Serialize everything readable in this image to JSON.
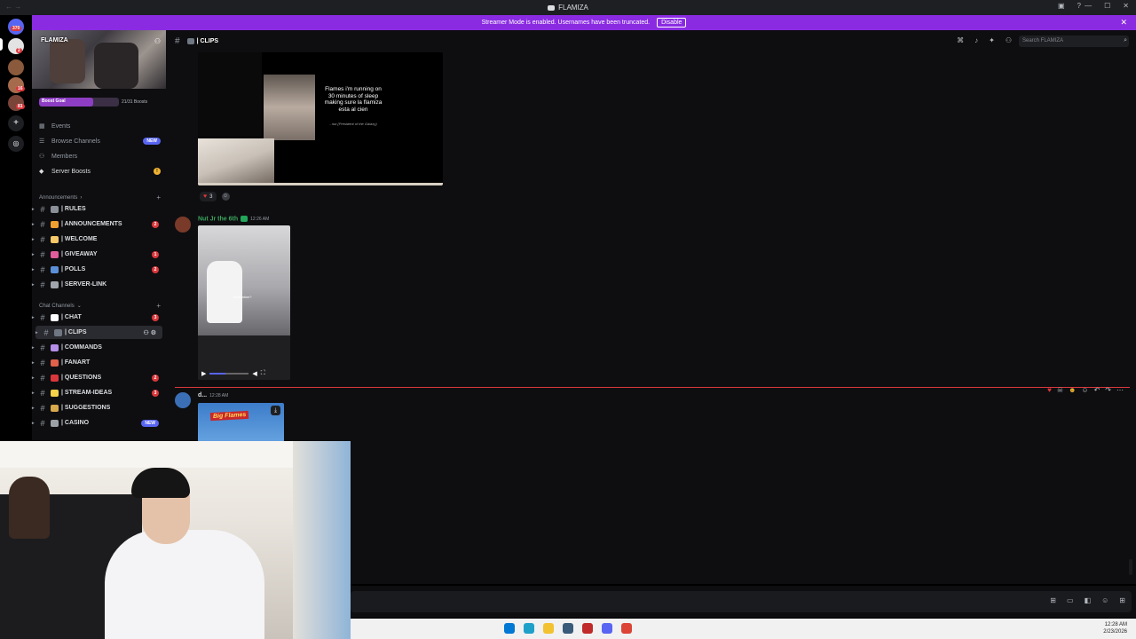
{
  "window": {
    "title": "FLAMIZA",
    "controls": [
      "—",
      "☐",
      "✕"
    ],
    "titlebar_icons": [
      "inbox-icon",
      "help-icon"
    ]
  },
  "banner": {
    "text": "Streamer Mode is enabled. Usernames have been truncated.",
    "disable_label": "Disable",
    "color": "#8a2be2"
  },
  "rail": {
    "badges": [
      "370",
      "2",
      "16",
      "81"
    ]
  },
  "server": {
    "name": "FLAMIZA",
    "boost_goal": {
      "label": "Boost Goal",
      "count": "21/31 Boosts",
      "progress": 0.68
    },
    "nav": [
      {
        "label": "Events",
        "icon": "calendar-icon"
      },
      {
        "label": "Browse Channels",
        "icon": "browse-channels-icon",
        "badge": "NEW"
      },
      {
        "label": "Members",
        "icon": "members-icon"
      },
      {
        "label": "Server Boosts",
        "icon": "boost-icon",
        "badge": "!"
      }
    ],
    "categories": [
      {
        "name": "Announcements",
        "channels": [
          {
            "name": "| RULES",
            "emoji_color": "#8a8f98",
            "count": ""
          },
          {
            "name": "| ANNOUNCEMENTS",
            "emoji_color": "#f0a030",
            "count": "2"
          },
          {
            "name": "| WELCOME",
            "emoji_color": "#f6c86a",
            "count": ""
          },
          {
            "name": "| GIVEAWAY",
            "emoji_color": "#e05c9a",
            "count": "1"
          },
          {
            "name": "| POLLS",
            "emoji_color": "#5b8fd8",
            "count": "2"
          },
          {
            "name": "| SERVER-LINK",
            "emoji_color": "#a0a4ab",
            "count": ""
          }
        ]
      },
      {
        "name": "Chat Channels",
        "channels": [
          {
            "name": "| CHAT",
            "emoji_color": "#ffffff",
            "count": "3"
          },
          {
            "name": "| CLIPS",
            "emoji_color": "#6f7782",
            "count": "",
            "active": true
          },
          {
            "name": "| COMMANDS",
            "emoji_color": "#b58ee8",
            "count": ""
          },
          {
            "name": "| FANART",
            "emoji_color": "#e0604c",
            "count": ""
          },
          {
            "name": "| QUESTIONS",
            "emoji_color": "#da373c",
            "count": "2"
          },
          {
            "name": "| STREAM-IDEAS",
            "emoji_color": "#f6d24a",
            "count": "3"
          },
          {
            "name": "| SUGGESTIONS",
            "emoji_color": "#d8a84c",
            "count": ""
          },
          {
            "name": "| CASINO",
            "emoji_color": "#9aa0a6",
            "count": "",
            "badge": "NEW"
          }
        ]
      }
    ]
  },
  "channel": {
    "name": "| CLIPS",
    "search_placeholder": "Search FLAMIZA",
    "header_icons": [
      "threads-icon",
      "notification-bell-icon",
      "pinned-icon",
      "members-list-icon"
    ]
  },
  "messages": [
    {
      "media_caption": "Flames i'm running on 30 minutes of sleep making sure la flamiza esta al cien",
      "media_credit": "- nut (President of the Galaxy)",
      "reaction_count": "3"
    },
    {
      "author": "Nut Jr the 6th",
      "author_color": "#3ba55d",
      "timestamp": "12:26 AM",
      "media_subtitle": "motivation?",
      "video_progress": 0.4
    },
    {
      "author": "d...",
      "author_color": "#dbdee1",
      "timestamp": "12:28 AM",
      "media_title": "Big Flames"
    }
  ],
  "message_actions": [
    "heart-reaction-icon",
    "skull-reaction-icon",
    "grin-reaction-icon",
    "add-reaction-icon",
    "reply-icon",
    "forward-icon",
    "more-icon"
  ],
  "composer_tools": [
    "gift-icon",
    "gif-icon",
    "sticker-icon",
    "emoji-icon",
    "apps-icon"
  ],
  "taskbar": {
    "time": "12:28 AM",
    "date": "2/23/2026",
    "apps": [
      {
        "name": "start-icon",
        "color": "#0078d4"
      },
      {
        "name": "edge-icon",
        "color": "#1fa0c9"
      },
      {
        "name": "file-explorer-icon",
        "color": "#f2c230"
      },
      {
        "name": "calculator-icon",
        "color": "#3a5b7a"
      },
      {
        "name": "app-icon",
        "color": "#c12a2a"
      },
      {
        "name": "discord-icon",
        "color": "#5865f2"
      },
      {
        "name": "chrome-icon",
        "color": "#db4437"
      }
    ]
  }
}
